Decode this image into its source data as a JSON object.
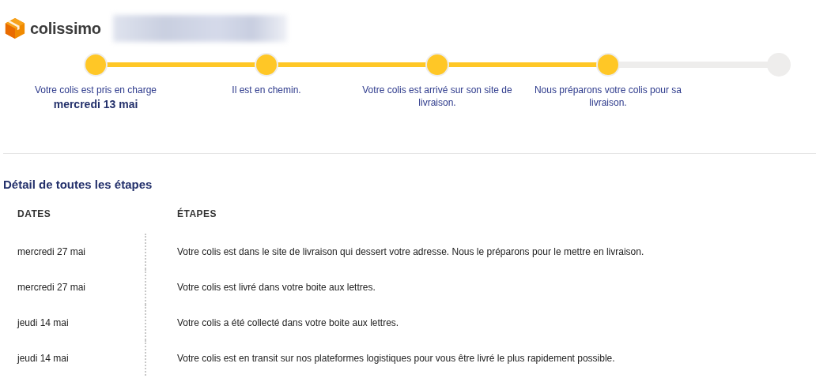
{
  "brand": {
    "name": "colissimo"
  },
  "steps": [
    {
      "label": "Votre colis est pris en charge",
      "date": "mercredi 13 mai",
      "done": true
    },
    {
      "label": "Il est en chemin.",
      "done": true
    },
    {
      "label": "Votre colis est arrivé sur son site de livraison.",
      "done": true
    },
    {
      "label": "Nous préparons votre colis pour sa livraison.",
      "done": true
    },
    {
      "done": false
    }
  ],
  "details": {
    "title": "Détail de toutes les étapes",
    "columns": [
      "DATES",
      "ÉTAPES"
    ],
    "rows": [
      {
        "date": "mercredi 27 mai",
        "step": "Votre colis est dans le site de livraison qui dessert votre adresse. Nous le préparons pour le mettre en livraison."
      },
      {
        "date": "mercredi 27 mai",
        "step": "Votre colis est livré dans votre boite aux lettres."
      },
      {
        "date": "jeudi 14 mai",
        "step": "Votre colis a été collecté dans votre boite aux lettres."
      },
      {
        "date": "jeudi 14 mai",
        "step": "Votre colis est en transit sur nos plateformes logistiques pour vous être livré le plus rapidement possible."
      }
    ]
  }
}
